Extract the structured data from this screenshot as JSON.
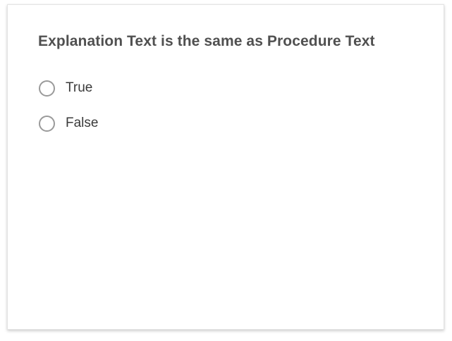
{
  "question": {
    "text": "Explanation Text is the same as Procedure Text"
  },
  "options": [
    {
      "label": "True",
      "selected": false
    },
    {
      "label": "False",
      "selected": false
    }
  ],
  "colors": {
    "question_text": "#505050",
    "option_text": "#3a3a3a",
    "radio_border": "#9a9a9a",
    "card_background": "#ffffff"
  }
}
